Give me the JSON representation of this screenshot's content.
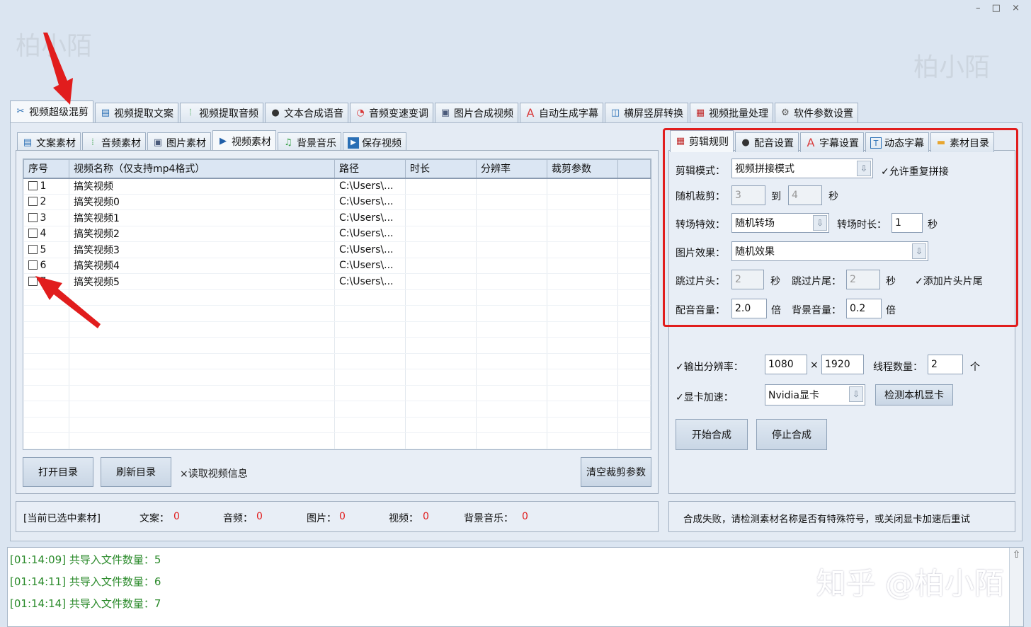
{
  "watermark": "柏小陌",
  "zhihu_mark": "知乎 @柏小陌",
  "window_controls": "– □ ×",
  "main_tabs": [
    {
      "label": "视频超级混剪",
      "icon": "scissors-icon",
      "glyph": "✂"
    },
    {
      "label": "视频提取文案",
      "icon": "document-icon",
      "glyph": "▤"
    },
    {
      "label": "视频提取音频",
      "icon": "waveform-icon",
      "glyph": "⦙"
    },
    {
      "label": "文本合成语音",
      "icon": "microphone-icon",
      "glyph": "●"
    },
    {
      "label": "音频变速变调",
      "icon": "speedometer-icon",
      "glyph": "◔"
    },
    {
      "label": "图片合成视频",
      "icon": "image-icon",
      "glyph": "▣"
    },
    {
      "label": "自动生成字幕",
      "icon": "font-icon",
      "glyph": "A"
    },
    {
      "label": "横屏竖屏转换",
      "icon": "rotate-screen-icon",
      "glyph": "◫"
    },
    {
      "label": "视频批量处理",
      "icon": "film-icon",
      "glyph": "▦"
    },
    {
      "label": "软件参数设置",
      "icon": "gear-icon",
      "glyph": "⚙"
    }
  ],
  "sub_tabs": [
    {
      "label": "文案素材",
      "icon": "document-icon",
      "glyph": "▤"
    },
    {
      "label": "音频素材",
      "icon": "waveform-icon",
      "glyph": "⦙"
    },
    {
      "label": "图片素材",
      "icon": "image-icon",
      "glyph": "▣"
    },
    {
      "label": "视频素材",
      "icon": "play-icon",
      "glyph": "▶"
    },
    {
      "label": "背景音乐",
      "icon": "music-icon",
      "glyph": "♫"
    },
    {
      "label": "保存视频",
      "icon": "save-play-icon",
      "glyph": "▶"
    }
  ],
  "table": {
    "headers": [
      "序号",
      "视频名称（仅支持mp4格式）",
      "路径",
      "时长",
      "分辨率",
      "裁剪参数"
    ],
    "rows": [
      {
        "no": "1",
        "name": "搞笑视频",
        "path": "C:\\Users\\..."
      },
      {
        "no": "2",
        "name": "搞笑视频0",
        "path": "C:\\Users\\..."
      },
      {
        "no": "3",
        "name": "搞笑视频1",
        "path": "C:\\Users\\..."
      },
      {
        "no": "4",
        "name": "搞笑视频2",
        "path": "C:\\Users\\..."
      },
      {
        "no": "5",
        "name": "搞笑视频3",
        "path": "C:\\Users\\..."
      },
      {
        "no": "6",
        "name": "搞笑视频4",
        "path": "C:\\Users\\..."
      },
      {
        "no": "7",
        "name": "搞笑视频5",
        "path": "C:\\Users\\..."
      }
    ]
  },
  "left_buttons": {
    "open_dir": "打开目录",
    "refresh_dir": "刷新目录",
    "read_info": "×读取视频信息",
    "clear_crop": "清空裁剪参数"
  },
  "status": {
    "selected": "[当前已选中素材]",
    "wenan_label": "文案：",
    "wenan": "0",
    "audio_label": "音频：",
    "audio": "0",
    "image_label": "图片：",
    "image": "0",
    "video_label": "视频：",
    "video": "0",
    "bgm_label": "背景音乐：",
    "bgm": "0"
  },
  "right_tabs": [
    {
      "label": "剪辑规则",
      "icon": "film-icon",
      "glyph": "▦"
    },
    {
      "label": "配音设置",
      "icon": "microphone-icon",
      "glyph": "●"
    },
    {
      "label": "字幕设置",
      "icon": "font-icon",
      "glyph": "A"
    },
    {
      "label": "动态字幕",
      "icon": "text-box-icon",
      "glyph": "T"
    },
    {
      "label": "素材目录",
      "icon": "folder-icon",
      "glyph": "▬"
    }
  ],
  "rules": {
    "mode_label": "剪辑模式：",
    "mode_value": "视频拼接模式",
    "allow_repeat": "✓允许重复拼接",
    "random_crop_label": "随机裁剪：",
    "crop_from": "3",
    "to": "到",
    "crop_to": "4",
    "sec": "秒",
    "transition_label": "转场特效：",
    "transition_value": "随机转场",
    "transition_dur_label": "转场时长：",
    "transition_dur": "1",
    "image_effect_label": "图片效果：",
    "image_effect_value": "随机效果",
    "skip_head_label": "跳过片头：",
    "skip_head": "2",
    "skip_tail_label": "跳过片尾：",
    "skip_tail": "2",
    "add_head_tail": "✓添加片头片尾",
    "voice_vol_label": "配音音量：",
    "voice_vol": "2.0",
    "times": "倍",
    "bgm_vol_label": "背景音量：",
    "bgm_vol": "0.2"
  },
  "output": {
    "res_label": "✓输出分辨率：",
    "res_w": "1080",
    "x": "×",
    "res_h": "1920",
    "threads_label": "线程数量：",
    "threads": "2",
    "unit": "个",
    "gpu_label": "✓显卡加速：",
    "gpu_value": "Nvidia显卡",
    "detect_gpu": "检测本机显卡",
    "start": "开始合成",
    "stop": "停止合成"
  },
  "message": "合成失败，请检测素材名称是否有特殊符号，或关闭显卡加速后重试",
  "log": [
    "[01:14:09] 共导入文件数量：5",
    "[01:14:11] 共导入文件数量：6",
    "[01:14:14] 共导入文件数量：7"
  ],
  "colors": {
    "highlight_frame": "#e11d1d",
    "log_text": "#2a8a2a",
    "status_value": "#e11d1d"
  }
}
